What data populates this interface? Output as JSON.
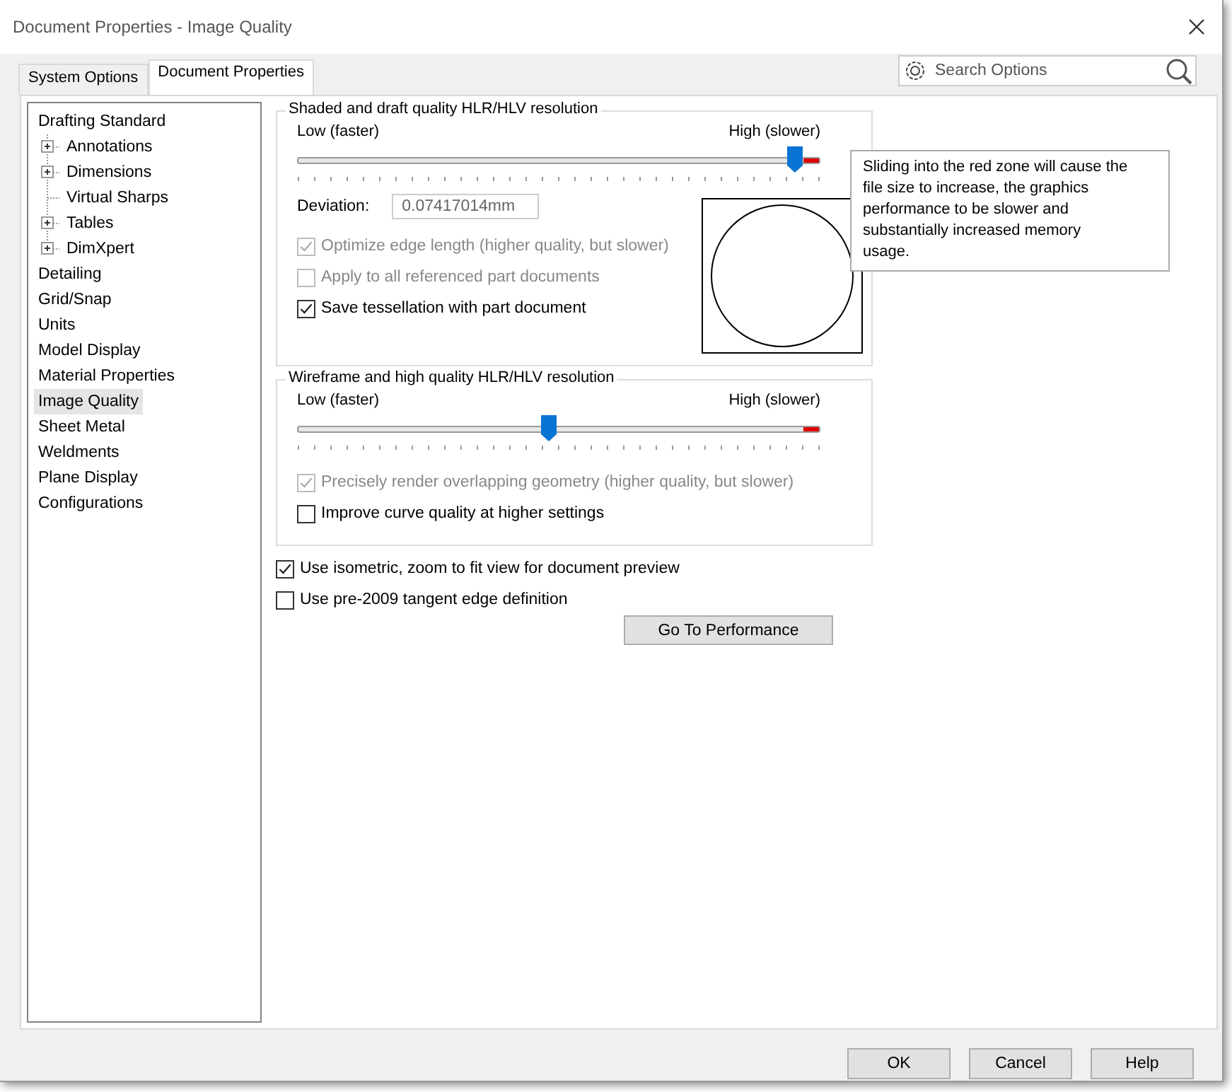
{
  "window": {
    "title": "Document Properties - Image Quality"
  },
  "tabs": [
    {
      "label": "System Options",
      "selected": false
    },
    {
      "label": "Document Properties",
      "selected": true
    }
  ],
  "search": {
    "placeholder": "Search Options"
  },
  "sidebar": {
    "items": [
      {
        "label": "Drafting Standard",
        "selected": false,
        "children": [
          {
            "label": "Annotations",
            "has_children": true
          },
          {
            "label": "Dimensions",
            "has_children": true
          },
          {
            "label": "Virtual Sharps",
            "has_children": false
          },
          {
            "label": "Tables",
            "has_children": true
          },
          {
            "label": "DimXpert",
            "has_children": true
          }
        ]
      },
      {
        "label": "Detailing",
        "selected": false
      },
      {
        "label": "Grid/Snap",
        "selected": false
      },
      {
        "label": "Units",
        "selected": false
      },
      {
        "label": "Model Display",
        "selected": false
      },
      {
        "label": "Material Properties",
        "selected": false
      },
      {
        "label": "Image Quality",
        "selected": true
      },
      {
        "label": "Sheet Metal",
        "selected": false
      },
      {
        "label": "Weldments",
        "selected": false
      },
      {
        "label": "Plane Display",
        "selected": false
      },
      {
        "label": "Configurations",
        "selected": false
      }
    ]
  },
  "shaded_group": {
    "title": "Shaded and draft quality HLR/HLV resolution",
    "low_label": "Low (faster)",
    "high_label": "High (slower)",
    "slider": {
      "level": 0.95
    },
    "deviation": {
      "label": "Deviation:",
      "value": "0.07417014mm"
    },
    "options": [
      {
        "label": "Optimize edge length (higher quality, but slower)",
        "checked": true,
        "disabled": true
      },
      {
        "label": "Apply to all referenced part documents",
        "checked": false,
        "disabled": true
      },
      {
        "label": "Save tessellation with part document",
        "checked": true,
        "disabled": false
      }
    ]
  },
  "tooltip": "Sliding into the red zone will cause the file size to increase, the graphics performance to be slower and substantially increased memory usage.",
  "wireframe_group": {
    "title": "Wireframe and high quality HLR/HLV resolution",
    "low_label": "Low (faster)",
    "high_label": "High (slower)",
    "slider": {
      "level": 0.48
    },
    "options": [
      {
        "label": "Precisely render overlapping geometry (higher quality, but slower)",
        "checked": true,
        "disabled": true
      },
      {
        "label": "Improve curve quality at higher settings",
        "checked": false,
        "disabled": false
      }
    ]
  },
  "options": [
    {
      "label": "Use isometric, zoom to fit view for document preview",
      "checked": true,
      "disabled": false
    },
    {
      "label": "Use pre-2009 tangent edge definition",
      "checked": false,
      "disabled": false
    }
  ],
  "performance_button": "Go To Performance",
  "buttons": [
    "OK",
    "Cancel",
    "Help"
  ]
}
